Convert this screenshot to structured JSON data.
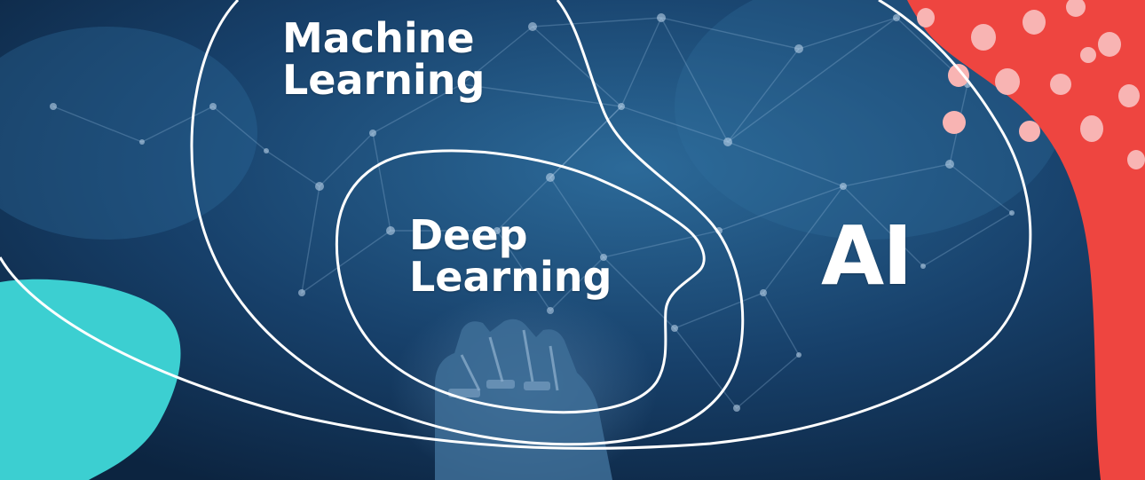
{
  "diagram": {
    "type": "nested-sets",
    "sets": [
      {
        "id": "ai",
        "label": "AI"
      },
      {
        "id": "machine-learning",
        "label": "Machine\nLearning",
        "inside": "ai"
      },
      {
        "id": "deep-learning",
        "label": "Deep\nLearning",
        "inside": "machine-learning"
      }
    ]
  },
  "colors": {
    "background": "#0f2c4f",
    "background_glow": "#2c6a99",
    "outline": "#ffffff",
    "teal_blob": "#3ccfd1",
    "red_blob": "#ee4540",
    "red_blob_dots": "#f8b4b3"
  }
}
